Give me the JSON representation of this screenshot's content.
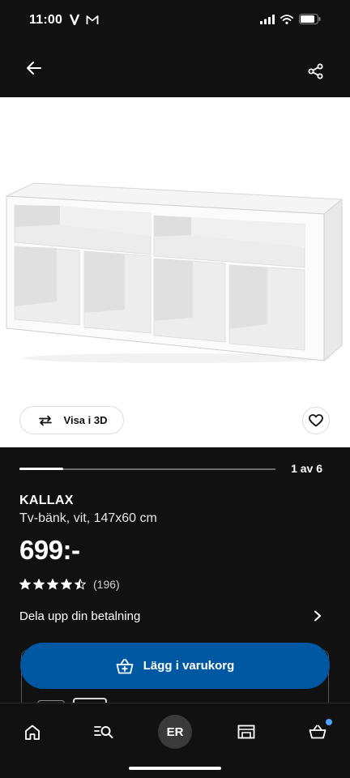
{
  "status_bar": {
    "time": "11:00",
    "app_icons": [
      "v-logo-icon",
      "gmail-icon"
    ],
    "system_icons": [
      "cellular-signal-icon",
      "wifi-icon",
      "battery-icon"
    ]
  },
  "header": {
    "back_icon": "arrow-left-icon",
    "share_icon": "share-icon"
  },
  "product_image": {
    "view3d_label": "Visa i 3D",
    "view3d_icon": "rotate-3d-icon",
    "favorite_icon": "heart-outline-icon"
  },
  "carousel": {
    "counter": "1 av 6",
    "progress_fraction": 0.17
  },
  "product": {
    "name": "KALLAX",
    "description": "Tv-bänk, vit, 147x60 cm",
    "price": "699:-",
    "rating_stars": 4.5,
    "rating_count": "(196)"
  },
  "installment": {
    "label": "Dela upp din betalning",
    "chevron_icon": "chevron-right-icon"
  },
  "cart_button": {
    "label": "Lägg i varukorg",
    "icon": "basket-add-icon",
    "color": "#0058a3"
  },
  "bottom_nav": {
    "items": [
      "home-icon",
      "search-list-icon",
      "profile-avatar",
      "store-icon",
      "basket-icon"
    ],
    "avatar_initials": "ER",
    "cart_badge_color": "#4da3ff"
  }
}
